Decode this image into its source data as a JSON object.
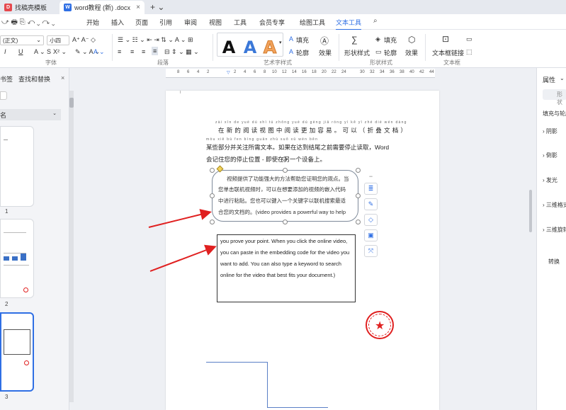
{
  "tabs": [
    {
      "label": "找稿壳模板",
      "icon": "wps-template-icon"
    },
    {
      "label": "word教程 (新) .docx",
      "icon": "word-doc-icon"
    }
  ],
  "menu": [
    "开始",
    "插入",
    "页面",
    "引用",
    "审阅",
    "视图",
    "工具",
    "会员专享",
    "绘图工具",
    "文本工具"
  ],
  "ribbon": {
    "font_name": "(正文)",
    "font_size": "小四",
    "groups": {
      "font": "字体",
      "paragraph": "段落",
      "art": "艺术字样式",
      "shape": "形状样式",
      "textbox": "文本框"
    },
    "fill": "填充",
    "outline": "轮廓",
    "effect": "效果",
    "shape_style": "形状样式",
    "shape_fill": "填充",
    "shape_outline": "轮廓",
    "shape_effect": "效果",
    "textbox_link": "文本框链接"
  },
  "nav": {
    "tabs": [
      "书签",
      "查找和替换"
    ],
    "header": "名",
    "pages": [
      "1",
      "2",
      "3"
    ]
  },
  "ruler": [
    "8",
    "6",
    "4",
    "2",
    "2",
    "4",
    "6",
    "8",
    "10",
    "12",
    "14",
    "16",
    "18",
    "20",
    "22",
    "24",
    "26",
    "30",
    "32",
    "34",
    "36",
    "38",
    "40",
    "42",
    "44"
  ],
  "document": {
    "pinyin": "zài xīn de yuè dú shì tú zhōng yuè dú gèng jiā róng yì  kě yǐ  zhé dié wén dàng",
    "line1": "在新的阅读视图中阅读更加容易。可以（折叠文档）",
    "pinyin2": "mòu xiē bù fen bìng guān zhù suǒ xū wén běn",
    "line2": "某些部分并关注所需文本。如果在达到结尾之前需要停止读取，Word",
    "line3": "会记住您的停止位置 - 即使在另一个设备上。",
    "textbox1": [
      "视频提供了功能强大的方法帮助您证明您的观点。当",
      "您单击联机视频时，可以在想要添加的视频的嵌入代码",
      "中进行粘贴。您也可以键入一个关键字以联机搜索最适",
      "合您的文档的。(video provides a powerful way to help"
    ],
    "textbox2": [
      "you prove your point. When you click the online video,",
      "you can paste in the embedding code for the video you",
      "want to add. You can also type a keyword to search",
      "online for the video that best fits your document.)"
    ]
  },
  "right_panel": {
    "title": "属性",
    "shape_tab": "形状",
    "section": "填充与轮廓",
    "items": [
      "阴影",
      "倒影",
      "发光",
      "三维格式",
      "三维旋转",
      "转换"
    ]
  },
  "colors": {
    "accent": "#2f6fe4",
    "arrow": "#e02020"
  }
}
